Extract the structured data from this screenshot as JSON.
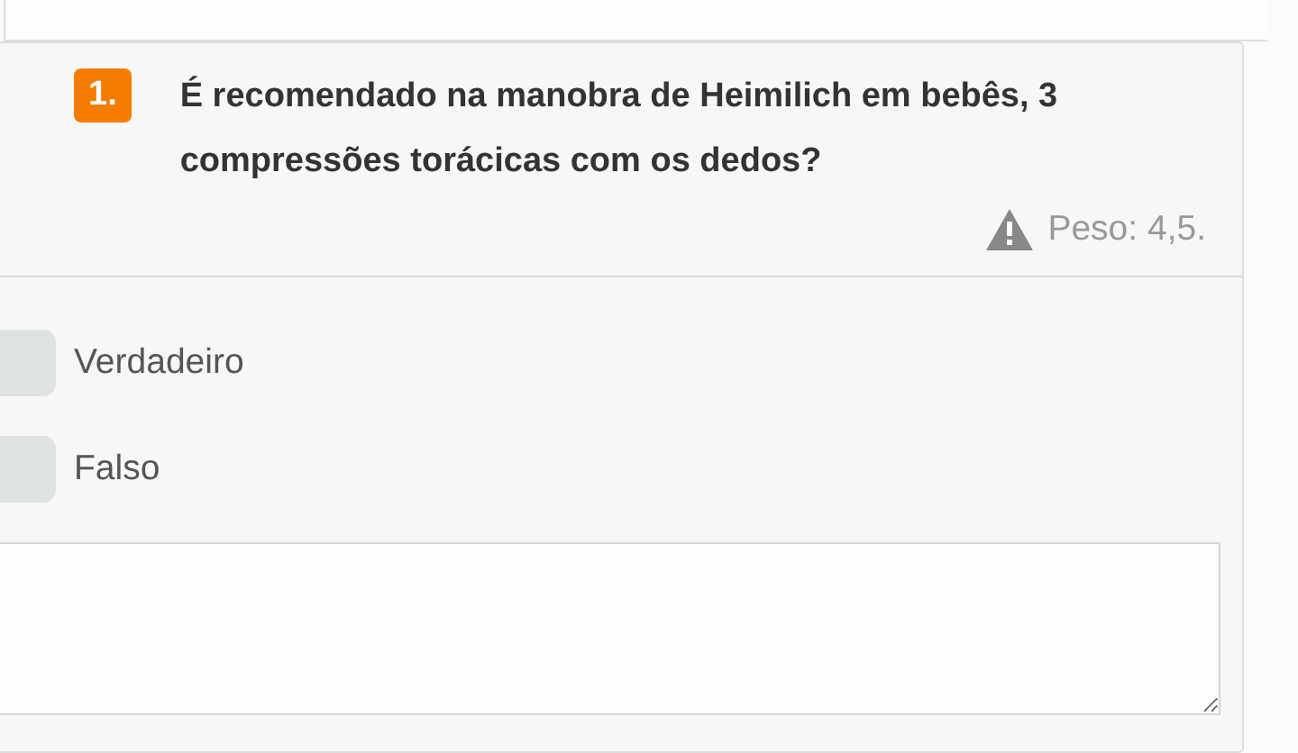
{
  "question": {
    "number": "1.",
    "text": "É recomendado na manobra de Heimilich em bebês, 3 compressões torácicas com os dedos?",
    "weight": "Peso: 4,5."
  },
  "options": [
    {
      "label": "Verdadeiro",
      "selected": false
    },
    {
      "label": "Falso",
      "selected": false
    }
  ]
}
